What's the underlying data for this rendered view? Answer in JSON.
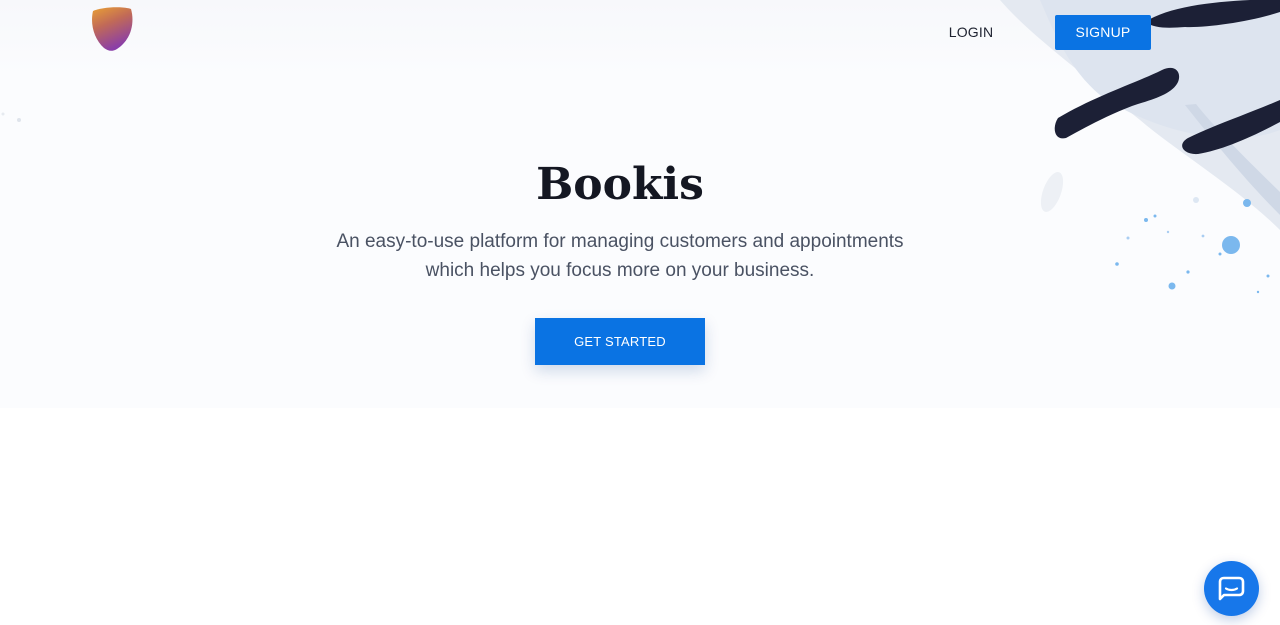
{
  "header": {
    "logo_icon": "shield-gradient-logo-icon",
    "login_label": "LOGIN",
    "signup_label": "SIGNUP"
  },
  "hero": {
    "title": "Bookis",
    "subtitle_line1": "An easy-to-use platform for managing customers and appointments",
    "subtitle_line2": "which helps you focus more on your business.",
    "cta_label": "GET STARTED"
  },
  "chat": {
    "icon": "chat-bubble-icon"
  },
  "colors": {
    "accent": "#0A73E3",
    "title_text": "#141722",
    "subtitle_text": "#4A5263",
    "brush_dark": "#1C2036",
    "splash_blue": "#7BB8EE"
  }
}
